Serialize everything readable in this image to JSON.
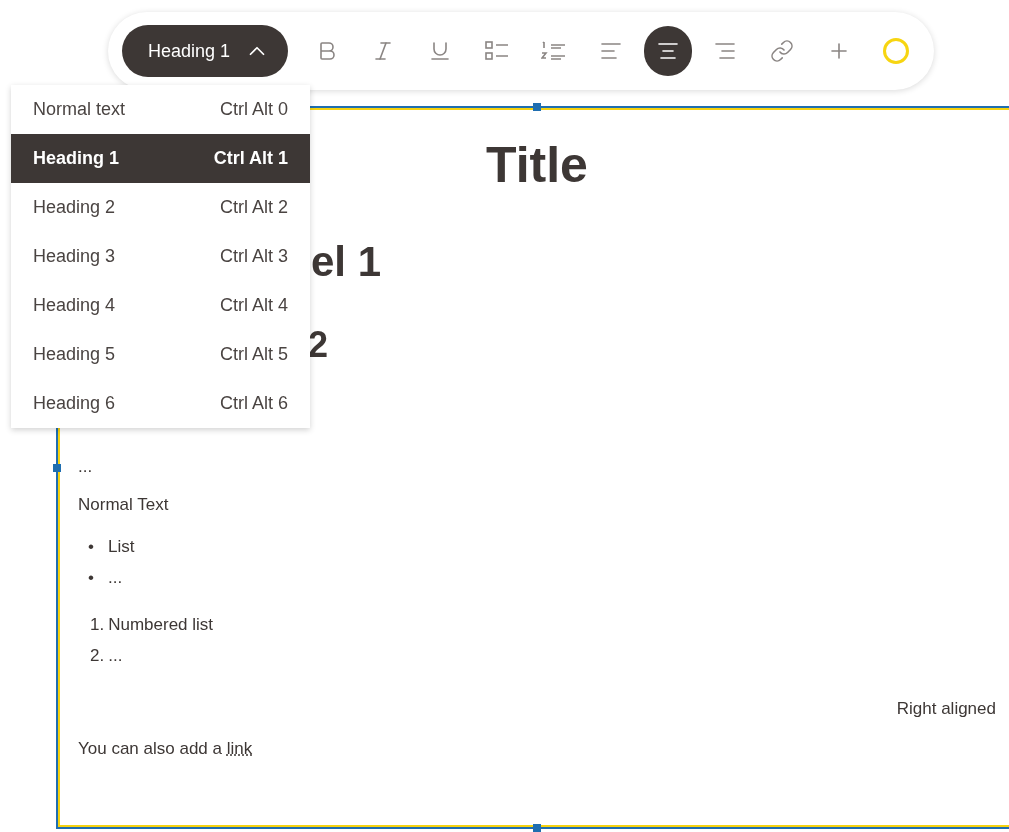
{
  "toolbar": {
    "style_dropdown": {
      "label": "Heading 1",
      "expanded": true
    },
    "buttons": [
      {
        "kind": "bold",
        "selected": false
      },
      {
        "kind": "italic",
        "selected": false
      },
      {
        "kind": "underline",
        "selected": false
      },
      {
        "kind": "bullet-list",
        "selected": false
      },
      {
        "kind": "numbered-list",
        "selected": false
      },
      {
        "kind": "align-left",
        "selected": false
      },
      {
        "kind": "align-center",
        "selected": true
      },
      {
        "kind": "align-right",
        "selected": false
      },
      {
        "kind": "link",
        "selected": false
      },
      {
        "kind": "insert",
        "selected": false
      },
      {
        "kind": "color",
        "selected": false,
        "color": "#f7d511"
      }
    ]
  },
  "style_menu": [
    {
      "label": "Normal text",
      "shortcut": "Ctrl Alt 0",
      "selected": false
    },
    {
      "label": "Heading 1",
      "shortcut": "Ctrl Alt 1",
      "selected": true
    },
    {
      "label": "Heading 2",
      "shortcut": "Ctrl Alt 2",
      "selected": false
    },
    {
      "label": "Heading 3",
      "shortcut": "Ctrl Alt 3",
      "selected": false
    },
    {
      "label": "Heading 4",
      "shortcut": "Ctrl Alt 4",
      "selected": false
    },
    {
      "label": "Heading 5",
      "shortcut": "Ctrl Alt 5",
      "selected": false
    },
    {
      "label": "Heading 6",
      "shortcut": "Ctrl Alt 6",
      "selected": false
    }
  ],
  "document": {
    "title": "Title",
    "heading_1": "el 1",
    "heading_2": "2",
    "ellipsis": "...",
    "paragraph": "Normal Text",
    "bullet_list": [
      {
        "marker": "•",
        "text": "List"
      },
      {
        "marker": "•",
        "text": "..."
      }
    ],
    "numbered_list": [
      {
        "number": "1.",
        "text": "Numbered list"
      },
      {
        "number": "2.",
        "text": "..."
      }
    ],
    "right_aligned": "Right aligned",
    "link_sentence": {
      "text": "You can also add a ",
      "link": "link"
    }
  }
}
